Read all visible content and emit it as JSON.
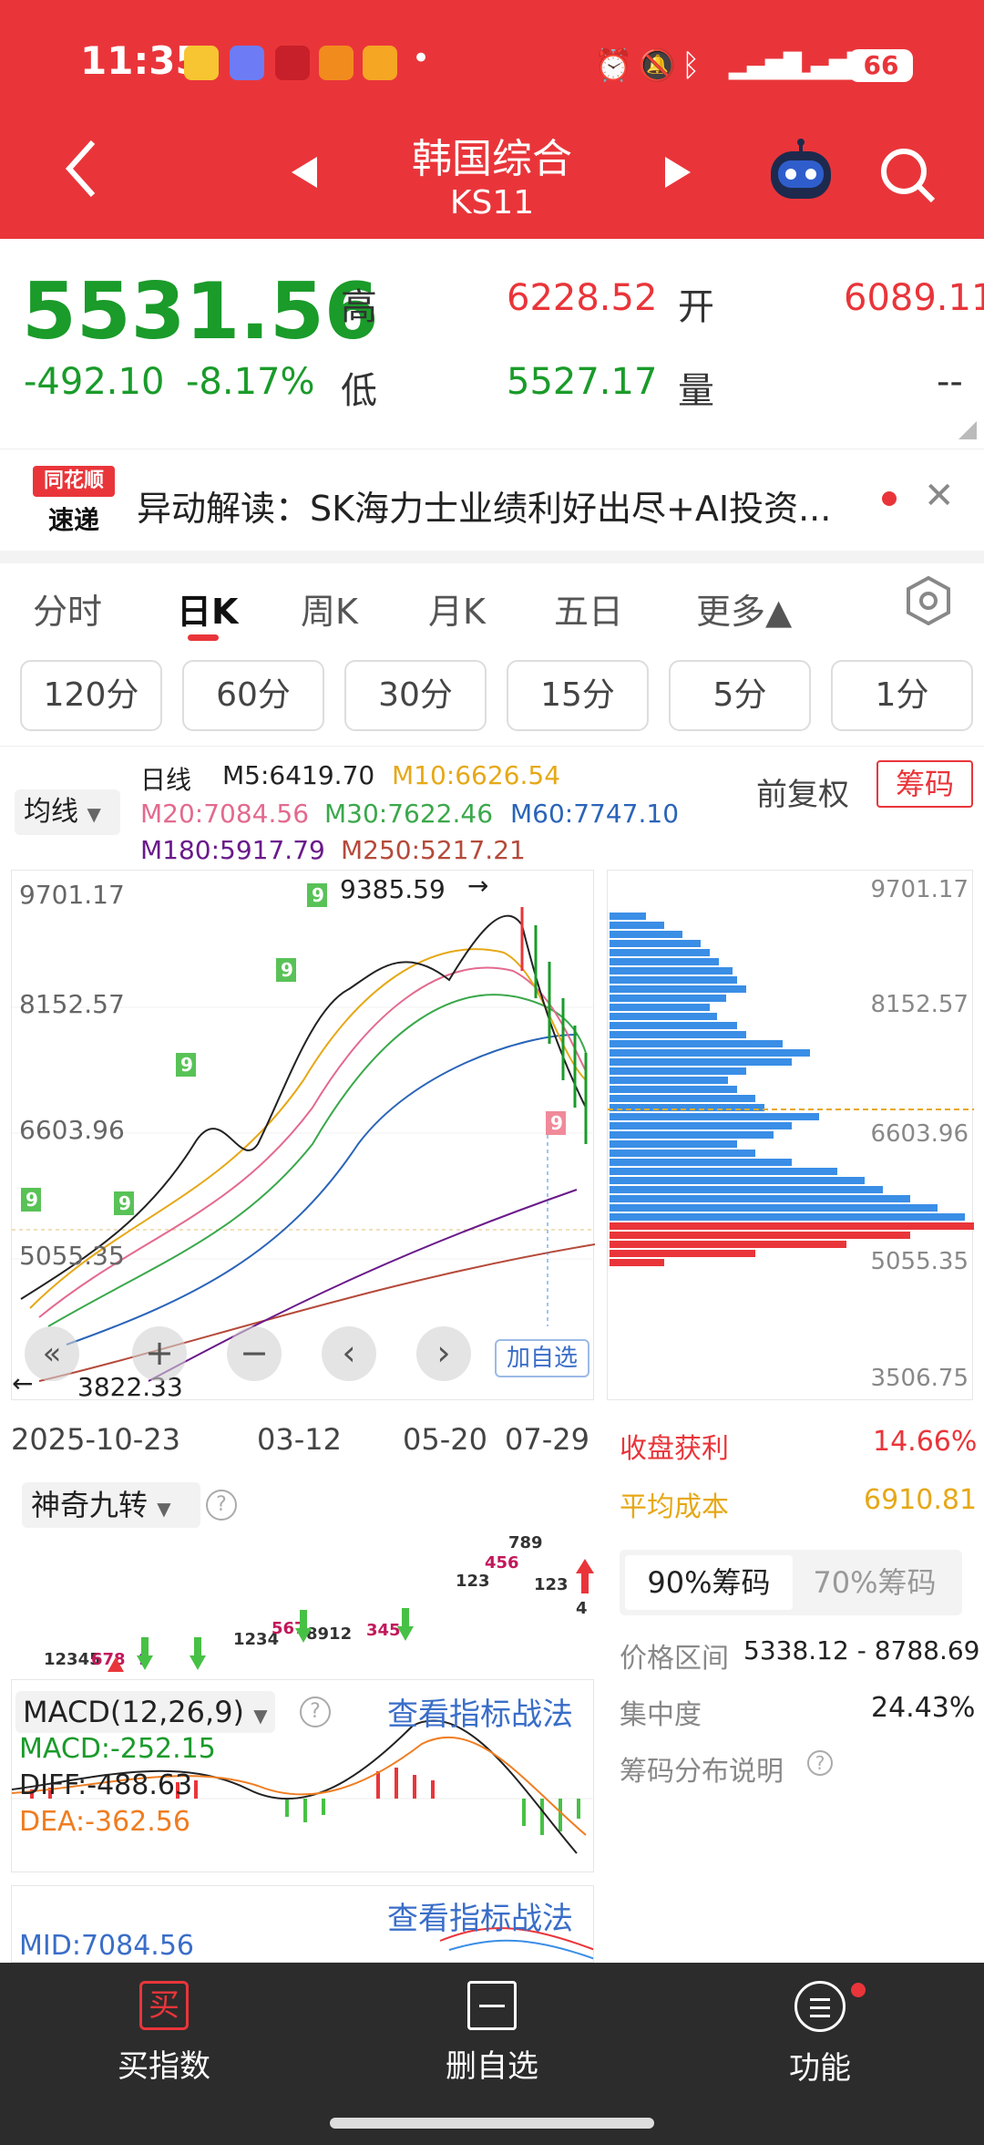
{
  "status_bar": {
    "time": "11:35",
    "battery": "66",
    "network": "5G"
  },
  "header": {
    "title": "韩国综合",
    "code": "KS11"
  },
  "quote": {
    "price": "5531.56",
    "change": "-492.10",
    "change_pct": "-8.17%",
    "high_label": "高",
    "high": "6228.52",
    "low_label": "低",
    "low": "5527.17",
    "open_label": "开",
    "open": "6089.11",
    "volume_label": "量",
    "volume": "--"
  },
  "news": {
    "logo_top": "同花顺",
    "logo_bottom": "速递",
    "text": "异动解读：SK海力士业绩利好出尽+AI投资..."
  },
  "tabs": [
    "分时",
    "日K",
    "周K",
    "月K",
    "五日",
    "更多▲"
  ],
  "periods": [
    "120分",
    "60分",
    "30分",
    "15分",
    "5分",
    "1分"
  ],
  "ma": {
    "selector": "均线",
    "label": "日线",
    "m5": "M5:6419.70",
    "m10": "M10:6626.54",
    "m20": "M20:7084.56",
    "m30": "M30:7622.46",
    "m60": "M60:7747.10",
    "m180": "M180:5917.79",
    "m250": "M250:5217.21",
    "fuquan": "前复权",
    "chouma": "筹码"
  },
  "kline": {
    "y_labels": [
      "9701.17",
      "8152.57",
      "6603.96",
      "5055.35"
    ],
    "high_mark": "9385.59",
    "low_mark": "3822.33",
    "dates": [
      "2025-10-23",
      "03-12",
      "05-20",
      "07-29"
    ],
    "add_watch": "加自选"
  },
  "chip": {
    "y_labels": [
      "9701.17",
      "8152.57",
      "6603.96",
      "5055.35",
      "3506.75"
    ],
    "profit_label": "收盘获利",
    "profit": "14.66%",
    "avg_cost_label": "平均成本",
    "avg_cost": "6910.81",
    "tab90": "90%筹码",
    "tab70": "70%筹码",
    "range_label": "价格区间",
    "range": "5338.12 - 8788.69",
    "concentration_label": "集中度",
    "concentration": "24.43%",
    "explain": "筹码分布说明"
  },
  "indicators": {
    "jiuzhuan": "神奇九转",
    "macd_name": "MACD(12,26,9)",
    "view_link": "查看指标战法",
    "macd": "MACD:-252.15",
    "diff": "DIFF:-488.63",
    "dea": "DEA:-362.56",
    "mid": "MID:7084.56"
  },
  "bottom_nav": [
    {
      "label": "买指数",
      "icon": "buy-icon"
    },
    {
      "label": "删自选",
      "icon": "remove-watch-icon"
    },
    {
      "label": "功能",
      "icon": "menu-icon"
    }
  ],
  "colors": {
    "red": "#e9353a",
    "green": "#1a9b2a",
    "blue": "#3a8ee6",
    "orange": "#f0a030"
  }
}
